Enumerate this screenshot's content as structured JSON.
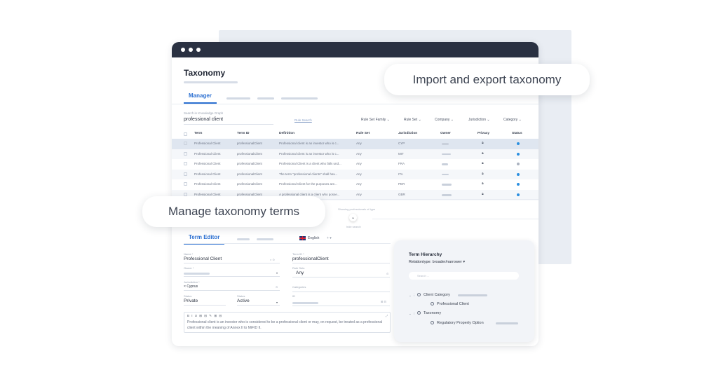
{
  "pills": {
    "export": "Import and export taxonomy",
    "manage": "Manage taxonomy terms"
  },
  "window": {
    "title": "Taxonomy",
    "active_tab": "Manager"
  },
  "search": {
    "label": "Search in Knowledge Graph",
    "value": "professional client",
    "rule_search": "Rule Search"
  },
  "filters": [
    "Rule Set Family",
    "Rule Set",
    "Company",
    "Jurisdiction",
    "Category"
  ],
  "table": {
    "columns": [
      "Term",
      "Term ID",
      "Definition",
      "Rule Set",
      "Jurisdiction",
      "Owner",
      "Privacy",
      "Status"
    ],
    "rows": [
      {
        "term": "Professional Client",
        "term_id": "professionalClient",
        "definition": "Professional client is an investor who is c...",
        "rule_set": "Any",
        "jurisdiction": "CYP",
        "status_color": "#2b8fe0"
      },
      {
        "term": "Professional Client",
        "term_id": "professionalClient",
        "definition": "Professional client is an investor who is c...",
        "rule_set": "Any",
        "jurisdiction": "MIT",
        "status_color": "#2b8fe0"
      },
      {
        "term": "Professional Client",
        "term_id": "professionalClient",
        "definition": "Professional Client is a client who falls und...",
        "rule_set": "Any",
        "jurisdiction": "FRA",
        "status_color": "#aab2bf"
      },
      {
        "term": "Professional Client",
        "term_id": "professionalClient",
        "definition": "The term \"professional clients\" shall hav...",
        "rule_set": "Any",
        "jurisdiction": "ITA",
        "status_color": "#2b8fe0"
      },
      {
        "term": "Professional Client",
        "term_id": "professionalClient",
        "definition": "Professional Client for the purposes are...",
        "rule_set": "Any",
        "jurisdiction": "PER",
        "status_color": "#2b8fe0"
      },
      {
        "term": "Professional Client",
        "term_id": "professionalClient",
        "definition": "A professional client is a client who posse...",
        "rule_set": "Any",
        "jurisdiction": "GBR",
        "status_color": "#2b8fe0"
      }
    ]
  },
  "pagination": {
    "showing": "Showing professionals of type",
    "hide": "hide search"
  },
  "editor": {
    "tab": "Term Editor",
    "language": "English",
    "name_label": "Name *",
    "name_value": "Professional Client",
    "term_id_label": "Term ID *",
    "term_id_value": "professionalClient",
    "owner_label": "Owner *",
    "rule_set_label": "Rule Sets",
    "rule_set_value": "Any",
    "jurisdiction_label": "Jurisdiction *",
    "jurisdiction_value": "Cyprus",
    "categories_label": "Categories",
    "status_label": "Status",
    "status_value": "Private",
    "lifecycle_label": "Status",
    "lifecycle_value": "Active",
    "id_label": "ID",
    "toolbar": "B I U  ⊞ ⊟  ✎  ⊞ ⊟",
    "definition": "Professional client is an investor who is considered to be a professional client or may, on request, be treated as a professional client within the meaning of Annex II to MiFID II."
  },
  "hierarchy": {
    "title": "Term Hierarchy",
    "relation": "Relationtype:  broader/narrower ▾",
    "search_placeholder": "Search ...",
    "items": [
      {
        "label": "Client Category"
      },
      {
        "label": "Professional Client"
      },
      {
        "label": "Taxonomy"
      },
      {
        "label": "Regulatory Property Option"
      }
    ]
  },
  "colors": {
    "accent": "#2b6fd1",
    "titlebar": "#2a3142",
    "status_active": "#2b8fe0"
  }
}
